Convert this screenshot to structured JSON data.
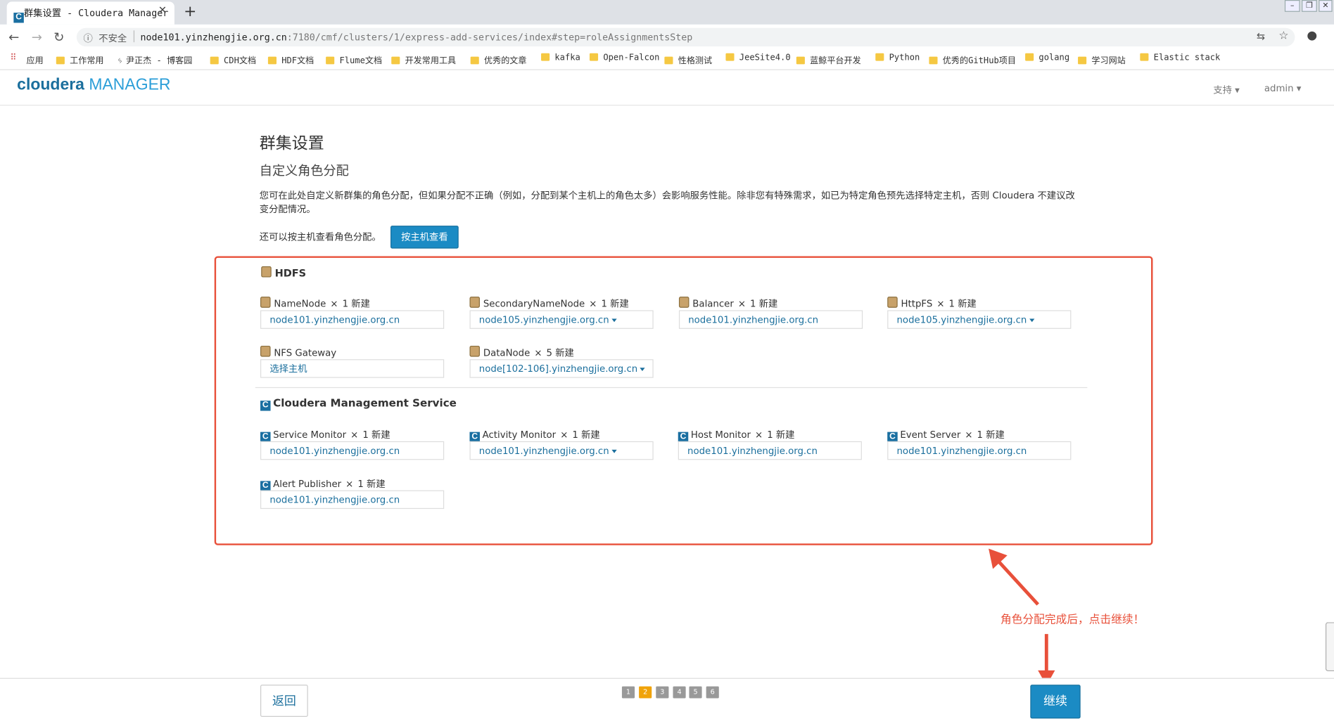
{
  "browser": {
    "tab_title": "群集设置 - Cloudera Manager",
    "security_label": "不安全",
    "url_host": "node101.yinzhengjie.org.cn",
    "url_path": ":7180/cmf/clusters/1/express-add-services/index#step=roleAssignmentsStep",
    "bookmarks": [
      "应用",
      "工作常用",
      "尹正杰 - 博客园",
      "CDH文档",
      "HDF文档",
      "Flume文档",
      "开发常用工具",
      "优秀的文章",
      "kafka",
      "Open-Falcon",
      "性格测试",
      "JeeSite4.0",
      "蓝鲸平台开发",
      "Python",
      "优秀的GitHub项目",
      "golang",
      "学习网站",
      "Elastic stack"
    ]
  },
  "header": {
    "logo_primary": "cloudera",
    "logo_secondary": "MANAGER",
    "support": "支持",
    "user": "admin"
  },
  "page": {
    "title": "群集设置",
    "subtitle": "自定义角色分配",
    "description": "您可在此处自定义新群集的角色分配，但如果分配不正确（例如，分配到某个主机上的角色太多）会影响服务性能。除非您有特殊需求，如已为特定角色预先选择特定主机，否则 Cloudera 不建议改变分配情况。",
    "host_view_hint": "还可以按主机查看角色分配。",
    "host_view_button": "按主机查看"
  },
  "hdfs": {
    "title": "HDFS",
    "roles": [
      {
        "name": "NameNode",
        "x": "×",
        "count": "1 新建",
        "host": "node101.yinzhengjie.org.cn",
        "dropdown": false
      },
      {
        "name": "SecondaryNameNode",
        "x": "×",
        "count": "1 新建",
        "host": "node105.yinzhengjie.org.cn",
        "dropdown": true
      },
      {
        "name": "Balancer",
        "x": "×",
        "count": "1 新建",
        "host": "node101.yinzhengjie.org.cn",
        "dropdown": false
      },
      {
        "name": "HttpFS",
        "x": "×",
        "count": "1 新建",
        "host": "node105.yinzhengjie.org.cn",
        "dropdown": true
      },
      {
        "name": "NFS Gateway",
        "x": "",
        "count": "",
        "host": "选择主机",
        "dropdown": false
      },
      {
        "name": "DataNode",
        "x": "×",
        "count": "5 新建",
        "host": "node[102-106].yinzhengjie.org.cn",
        "dropdown": true
      }
    ]
  },
  "cms": {
    "title": "Cloudera Management Service",
    "roles": [
      {
        "name": "Service Monitor",
        "x": "×",
        "count": "1 新建",
        "host": "node101.yinzhengjie.org.cn",
        "dropdown": false
      },
      {
        "name": "Activity Monitor",
        "x": "×",
        "count": "1 新建",
        "host": "node101.yinzhengjie.org.cn",
        "dropdown": true
      },
      {
        "name": "Host Monitor",
        "x": "×",
        "count": "1 新建",
        "host": "node101.yinzhengjie.org.cn",
        "dropdown": false
      },
      {
        "name": "Event Server",
        "x": "×",
        "count": "1 新建",
        "host": "node101.yinzhengjie.org.cn",
        "dropdown": false
      },
      {
        "name": "Alert Publisher",
        "x": "×",
        "count": "1 新建",
        "host": "node101.yinzhengjie.org.cn",
        "dropdown": false
      }
    ]
  },
  "annotation": "角色分配完成后，点击继续！",
  "footer": {
    "back": "返回",
    "continue": "继续",
    "steps": [
      "1",
      "2",
      "3",
      "4",
      "5",
      "6"
    ],
    "current_step": "2"
  },
  "colors": {
    "accent": "#1b8bc4",
    "highlight": "#e8503a",
    "link": "#1b6f9d",
    "step_active": "#f0a30a"
  }
}
